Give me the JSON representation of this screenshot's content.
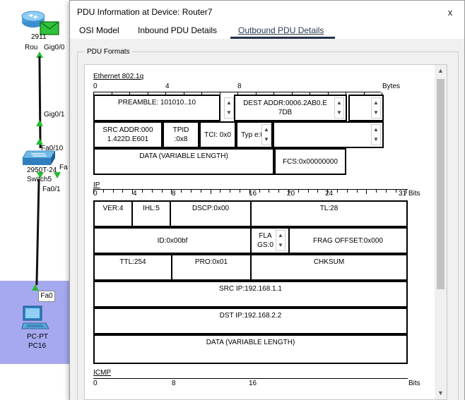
{
  "canvas": {
    "router_label_top": "2911",
    "router_label": "Rou",
    "router_port_gig00": "Gig0/0",
    "router_port_gig01": "Gig0/1",
    "switch_port_fa010": "Fa0/10",
    "switch_label_top": "2950T-24",
    "switch_label": "Switch5",
    "switch_port_fa": "Fa",
    "switch_port_fa01": "Fa0/1",
    "pc_port_fa0": "Fa0",
    "pc_type": "PC-PT",
    "pc_name": "PC16",
    "colors": {
      "selection": "#a7a9f0",
      "link_up": "#22bb33"
    }
  },
  "dialog": {
    "title": "PDU Information at Device: Router7",
    "close_label": "x",
    "tabs": [
      {
        "label": "OSI Model"
      },
      {
        "label": "Inbound PDU Details"
      },
      {
        "label": "Outbound PDU Details",
        "active": true
      }
    ],
    "group_label": "PDU Formats"
  },
  "ethernet": {
    "title": "Ethernet 802.1q",
    "ruler": [
      "0",
      "4",
      "8"
    ],
    "unit": "Bytes",
    "preamble": "PREAMBLE: 101010..10",
    "dest_addr": "DEST ADDR:0006.2AB0.E 7DB",
    "src_addr": "SRC ADDR:000 1.422D.E601",
    "tpid": "TPID :0x8",
    "tci": "TCI: 0x0",
    "typ": "Typ e:0x",
    "data": "DATA (VARIABLE LENGTH)",
    "fcs": "FCS:0x00000000"
  },
  "ip": {
    "title": "IP",
    "ruler": [
      "0",
      "4",
      "8",
      "16",
      "20",
      "24",
      "31"
    ],
    "unit": "Bits",
    "ver": "VER:4",
    "ihl": "IHL:5",
    "dscp": "DSCP:0x00",
    "tl": "TL:28",
    "id": "ID:0x00bf",
    "flags": "FLA GS:0",
    "frag_offset": "FRAG OFFSET:0x000",
    "ttl": "TTL:254",
    "pro": "PRO:0x01",
    "chksum": "CHKSUM",
    "src_ip": "SRC IP:192.168.1.1",
    "dst_ip": "DST IP:192.168.2.2",
    "data": "DATA (VARIABLE LENGTH)"
  },
  "icmp": {
    "title": "ICMP",
    "ruler": [
      "0",
      "8",
      "16"
    ],
    "unit": "Bits"
  }
}
